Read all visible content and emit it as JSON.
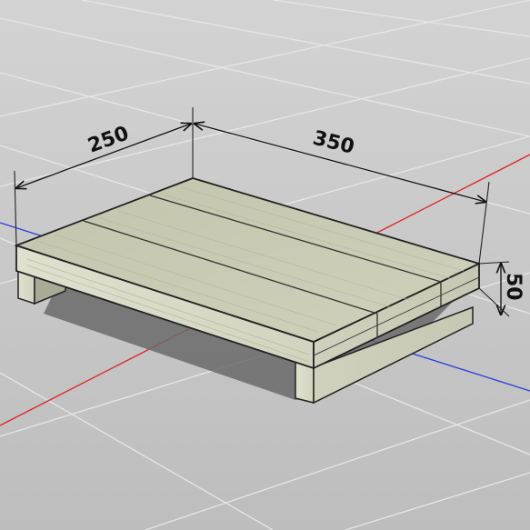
{
  "dimensions": {
    "width_label": "250",
    "length_label": "350",
    "height_label": "50"
  },
  "colors": {
    "background": "#c9c9c9",
    "grid_line": "#e4e4e4",
    "axis_x": "#e02020",
    "axis_y": "#2030e0",
    "wood_top": "#c5c7b0",
    "wood_side": "#d8dac6",
    "wood_edge": "#222222",
    "shadow": "#6d6d6d"
  }
}
